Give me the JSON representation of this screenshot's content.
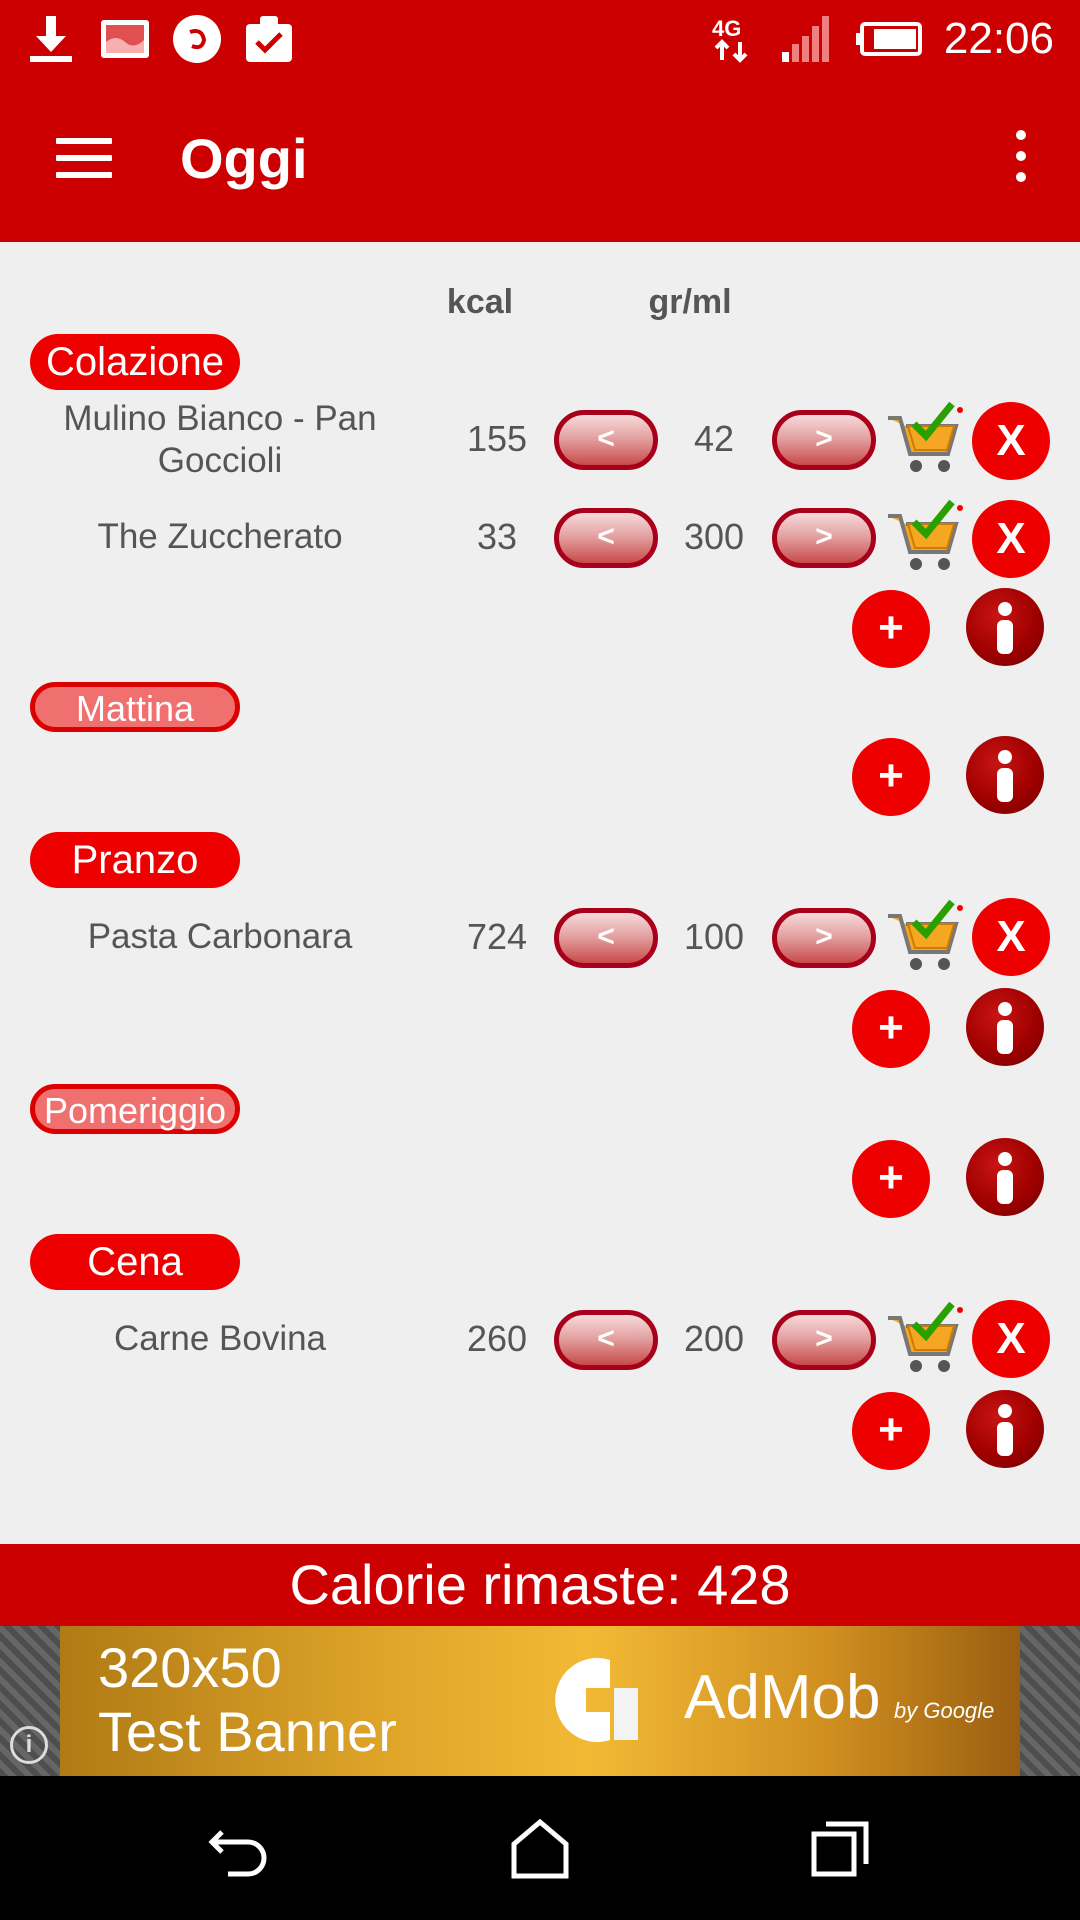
{
  "status": {
    "time": "22:06",
    "network": "4G"
  },
  "appbar": {
    "title": "Oggi"
  },
  "columns": {
    "kcal": "kcal",
    "grml": "gr/ml"
  },
  "meals": [
    {
      "label": "Colazione",
      "items": [
        {
          "name": "Mulino Bianco - Pan Goccioli",
          "kcal": "155",
          "qty": "42"
        },
        {
          "name": "The Zuccherato",
          "kcal": "33",
          "qty": "300"
        }
      ]
    },
    {
      "label": "Mattina",
      "items": []
    },
    {
      "label": "Pranzo",
      "items": [
        {
          "name": "Pasta Carbonara",
          "kcal": "724",
          "qty": "100"
        }
      ]
    },
    {
      "label": "Pomeriggio",
      "items": []
    },
    {
      "label": "Cena",
      "items": [
        {
          "name": "Carne Bovina",
          "kcal": "260",
          "qty": "200"
        }
      ]
    }
  ],
  "controls": {
    "decrease": "<",
    "increase": ">",
    "remove": "X",
    "add": "+"
  },
  "remaining": {
    "text": "Calorie rimaste: 428"
  },
  "ad": {
    "line1": "320x50",
    "line2": "Test Banner",
    "brand": "AdMob",
    "by": "by Google"
  },
  "colors": {
    "primary": "#cc0000",
    "accent": "#ee0000",
    "info": "#a00000"
  },
  "icons": [
    "download-icon",
    "image-icon",
    "music-icon",
    "clipboard-check-icon",
    "signal-icon",
    "battery-icon",
    "menu-icon",
    "more-vert-icon",
    "cart-check-icon",
    "info-icon",
    "back-icon",
    "home-icon",
    "recents-icon"
  ]
}
